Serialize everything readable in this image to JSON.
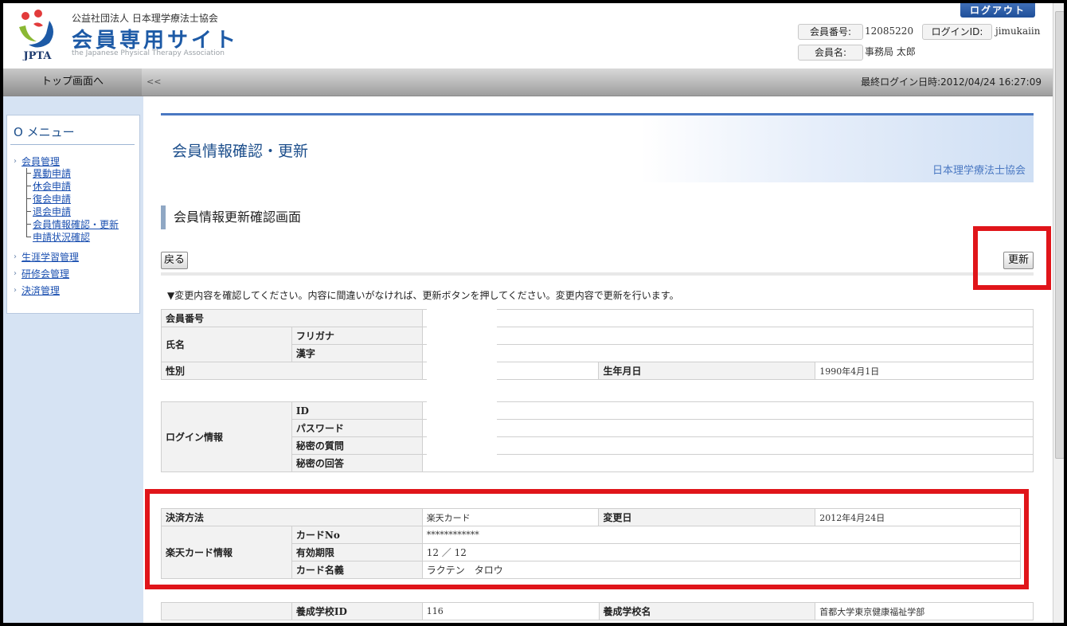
{
  "header": {
    "org_name": "公益社団法人 日本理学療法士協会",
    "site_title": "会員専用サイト",
    "site_sub": "the Japanese Physical Therapy Association",
    "logo_text": "JPTA",
    "logout_label": "ログアウト",
    "member_no_label": "会員番号:",
    "member_no": "12085220",
    "login_id_label": "ログインID:",
    "login_id": "jimukaiin",
    "member_name_label": "会員名:",
    "member_name": "事務局 太郎"
  },
  "nav": {
    "top_label": "トップ画面へ",
    "collapse_label": "<<",
    "last_login": "最終ログイン日時:2012/04/24 16:27:09"
  },
  "sidebar": {
    "menu_title": "O メニュー",
    "groups": [
      {
        "label": "会員管理",
        "children": [
          "異動申請",
          "休会申請",
          "復会申請",
          "退会申請",
          "会員情報確認・更新",
          "申請状況確認"
        ]
      },
      {
        "label": "生涯学習管理"
      },
      {
        "label": "研修会管理"
      },
      {
        "label": "決済管理"
      }
    ]
  },
  "banner": {
    "title": "会員情報確認・更新",
    "org": "日本理学療法士協会"
  },
  "section_title": "会員情報更新確認画面",
  "buttons": {
    "back": "戻る",
    "update": "更新"
  },
  "notice": "▼変更内容を確認してください。内容に間違いがなければ、更新ボタンを押してください。変更内容で更新を行います。",
  "basic": {
    "member_no": "会員番号",
    "name": "氏名",
    "furigana": "フリガナ",
    "kanji": "漢字",
    "gender": "性別",
    "birth_label": "生年月日",
    "birth": "1990年4月1日"
  },
  "login": {
    "group": "ログイン情報",
    "id": "ID",
    "password": "パスワード",
    "password_value": "*",
    "question": "秘密の質問",
    "answer": "秘密の回答"
  },
  "payment": {
    "method_label": "決済方法",
    "method": "楽天カード",
    "change_label": "変更日",
    "change_date": "2012年4月24日",
    "card_group": "楽天カード情報",
    "card_no_label": "カードNo",
    "card_no": "************",
    "expiry_label": "有効期限",
    "expiry": "12 ／ 12",
    "holder_label": "カード名義",
    "holder": "ラクテン　タロウ"
  },
  "school": {
    "id_label": "養成学校ID",
    "id": "116",
    "name_label": "養成学校名",
    "name": "首都大学東京健康福祉学部"
  },
  "colors": {
    "accent": "#1d5aa6",
    "highlight": "#e0151a",
    "sidebar_bg": "#d6e3f3"
  }
}
